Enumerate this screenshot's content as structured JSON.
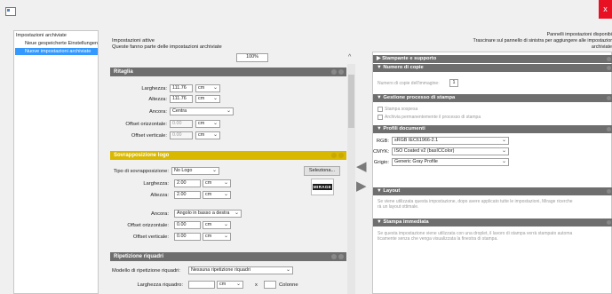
{
  "window": {
    "close_label": "x"
  },
  "left_tree": {
    "root": "Impostazioni archiviate",
    "items": [
      "Neue gespeicherte Einstellungen",
      "Nuove impostazioni archiviate"
    ]
  },
  "active": {
    "title": "Impostazioni attive",
    "subtitle": "Queste fanno parte delle impostazioni archiviate",
    "zoom": "100%",
    "scroll_up": "^"
  },
  "right_header": {
    "line1": "Pannelli impostazioni disponibi",
    "line2": "Trascinare sul pannello di sinistra per aggiungere alle impostazior",
    "line3": "archiviate"
  },
  "ritaglia": {
    "title": "Ritaglia",
    "larghezza_label": "Larghezza:",
    "larghezza_value": "111.76",
    "larghezza_unit": "cm",
    "altezza_label": "Altezza:",
    "altezza_value": "111.76",
    "altezza_unit": "cm",
    "ancora_label": "Ancora:",
    "ancora_value": "Centra",
    "offset_or_label": "Offset orizzontale:",
    "offset_or_value": "0.00",
    "offset_or_unit": "cm",
    "offset_vert_label": "Offset verticale:",
    "offset_vert_value": "0.00",
    "offset_vert_unit": "cm"
  },
  "logo": {
    "title": "Sovrapposizione logo",
    "tipo_label": "Tipo di sovrapposizione:",
    "tipo_value": "No Logo",
    "select_button": "Seleziona...",
    "larghezza_label": "Larghezza:",
    "larghezza_value": "2.00",
    "larghezza_unit": "cm",
    "altezza_label": "Altezza:",
    "altezza_value": "2.00",
    "altezza_unit": "cm",
    "ancora_label": "Ancora:",
    "ancora_value": "Angolo in basso a destra",
    "offset_or_label": "Offset orizzontale:",
    "offset_or_value": "0.00",
    "offset_or_unit": "cm",
    "offset_vert_label": "Offset verticale:",
    "offset_vert_value": "0.00",
    "offset_vert_unit": "cm",
    "preview_text": "MIRAGE"
  },
  "riquadri": {
    "title": "Ripetizione riquadri",
    "modello_label": "Modello di ripetizione riquadri:",
    "modello_value": "Nessuna ripetizione riquadri",
    "larghezza_label": "Larghezza riquadro:",
    "larghezza_unit": "cm",
    "x_label": "x",
    "colonne_label": "Colonne"
  },
  "arrows": {
    "left": "◀",
    "right": "▶"
  },
  "panels": {
    "stampante": {
      "title": "▶ Stampante e supporto"
    },
    "copie": {
      "title": "▼ Numero di copie",
      "label": "Numero di copie dell'immagine:",
      "value": "1"
    },
    "processo": {
      "title": "▼ Gestione processo di stampa",
      "opt1": "Stampa sospesa",
      "opt2": "Archivia permanentemente il processo di stampa"
    },
    "profili": {
      "title": "▼ Profili documenti",
      "rgb_label": "RGB:",
      "rgb_value": "sRGB IEC61966-2.1",
      "cmyk_label": "CMYK:",
      "cmyk_value": "ISO Coated v2 (basICColor)",
      "grigio_label": "Grigio:",
      "grigio_value": "Generic Gray Profile"
    },
    "layout": {
      "title": "▼ Layout",
      "desc1": "Se viene utilizzata questa impostazione, dopo avere applicato tutte le impostazioni, Mirage ricerche",
      "desc2": "rà un layout ottimale."
    },
    "immediata": {
      "title": "▼ Stampa immediata",
      "desc1": "Se questa impostazione viene utilizzata con una droplet, il lavoro di stampa verrà stampato automa",
      "desc2": "ticamente senza che venga visualizzata la finestra di stampa."
    }
  }
}
